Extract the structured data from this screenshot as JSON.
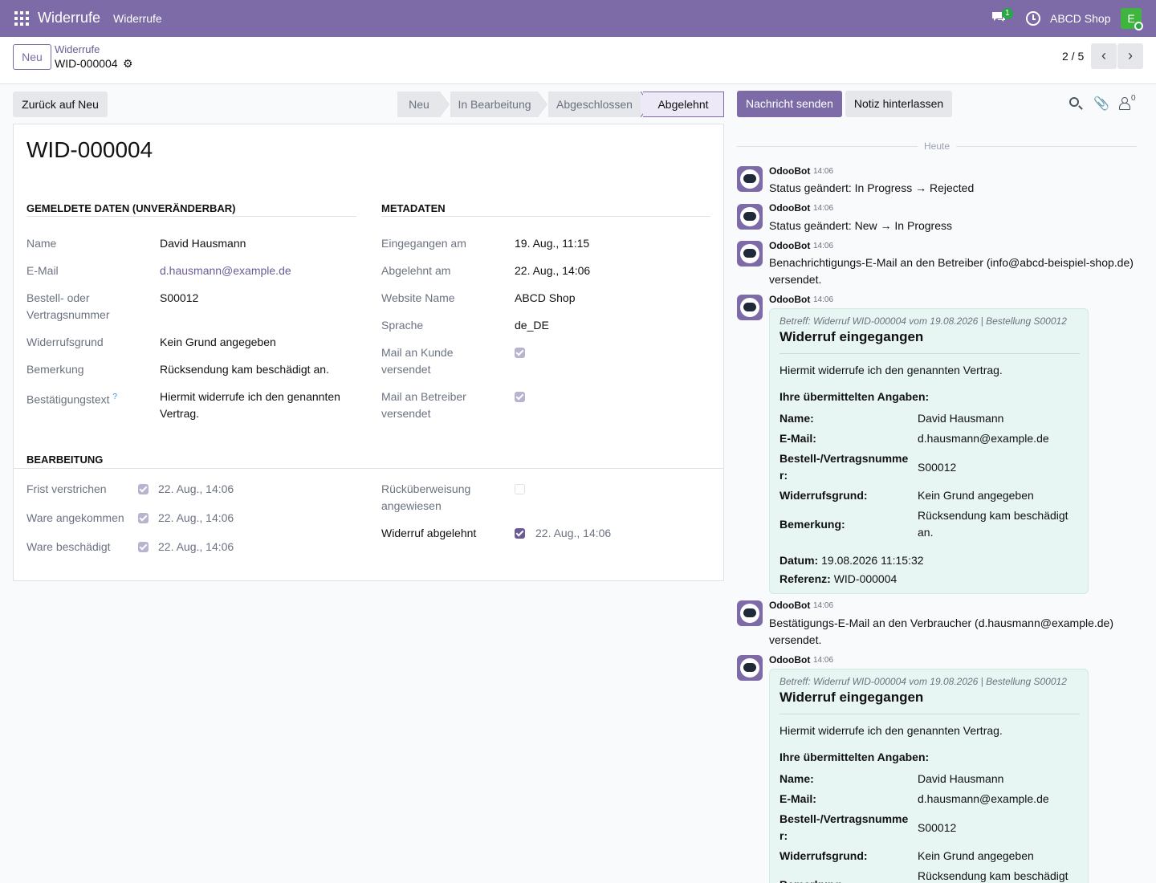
{
  "navbar": {
    "app_name": "Widerrufe",
    "menu_item": "Widerrufe",
    "chat_badge": "1",
    "company": "ABCD Shop",
    "avatar_letter": "E"
  },
  "control": {
    "new_button": "Neu",
    "breadcrumb_parent": "Widerrufe",
    "breadcrumb_current": "WID-000004",
    "pager": "2 / 5"
  },
  "statusbar": {
    "back_button": "Zurück auf Neu",
    "stages": [
      "Neu",
      "In Bearbeitung",
      "Abgeschlossen",
      "Abgelehnt"
    ],
    "active_stage": "Abgelehnt"
  },
  "form": {
    "title": "WID-000004",
    "group_reported": {
      "title": "Gemeldete Daten (unveränderbar)",
      "name_label": "Name",
      "name_value": "David Hausmann",
      "email_label": "E-Mail",
      "email_value": "d.hausmann@example.de",
      "order_label": "Bestell- oder Vertragsnummer",
      "order_value": "S00012",
      "reason_label": "Widerrufsgrund",
      "reason_value": "Kein Grund angegeben",
      "remark_label": "Bemerkung",
      "remark_value": "Rücksendung kam beschädigt an.",
      "confirm_label": "Bestätigungstext",
      "confirm_help": "?",
      "confirm_value": "Hiermit widerrufe ich den genannten Vertrag."
    },
    "group_meta": {
      "title": "Metadaten",
      "received_label": "Eingegangen am",
      "received_value": "19. Aug., 11:15",
      "rejected_label": "Abgelehnt am",
      "rejected_value": "22. Aug., 14:06",
      "website_label": "Website Name",
      "website_value": "ABCD Shop",
      "lang_label": "Sprache",
      "lang_value": "de_DE",
      "mail_customer_label": "Mail an Kunde versendet",
      "mail_customer_checked": true,
      "mail_operator_label": "Mail an Betreiber versendet",
      "mail_operator_checked": true
    },
    "group_processing": {
      "title": "Bearbeitung",
      "deadline_label": "Frist verstrichen",
      "deadline_date": "22. Aug., 14:06",
      "arrived_label": "Ware angekommen",
      "arrived_date": "22. Aug., 14:06",
      "damaged_label": "Ware beschädigt",
      "damaged_date": "22. Aug., 14:06",
      "refund_label": "Rücküberweisung angewiesen",
      "refund_checked": false,
      "rejected_label": "Widerruf abgelehnt",
      "rejected_date": "22. Aug., 14:06"
    }
  },
  "chatter": {
    "send_button": "Nachricht senden",
    "note_button": "Notiz hinterlassen",
    "follower_count": "0",
    "today_label": "Heute",
    "author": "OdooBot",
    "time": "14:06",
    "messages": [
      "Status geändert: In Progress → Rejected",
      "Status geändert: New → In Progress",
      "Benachrichtigungs-E-Mail an den Betreiber (info@abcd-beispiel-shop.de) versendet.",
      "Bestätigungs-E-Mail an den Verbraucher (d.hausmann@example.de) versendet."
    ],
    "mail": {
      "subject": "Betreff: Widerruf WID-000004 vom 19.08.2026 | Bestellung S00012",
      "heading": "Widerruf eingegangen",
      "intro": "Hiermit widerrufe ich den genannten Vertrag.",
      "details_heading": "Ihre übermittelten Angaben:",
      "name_key": "Name:",
      "name_val": "David Hausmann",
      "email_key": "E-Mail:",
      "email_val": "d.hausmann@example.de",
      "order_key": "Bestell-/Vertragsnummer:",
      "order_val": "S00012",
      "reason_key": "Widerrufsgrund:",
      "reason_val": "Kein Grund angegeben",
      "remark_key": "Bemerkung:",
      "remark_val": "Rücksendung kam beschädigt an.",
      "date_key": "Datum:",
      "date_val": "19.08.2026 11:15:32",
      "ref_key": "Referenz:",
      "ref_val": "WID-000004"
    }
  }
}
